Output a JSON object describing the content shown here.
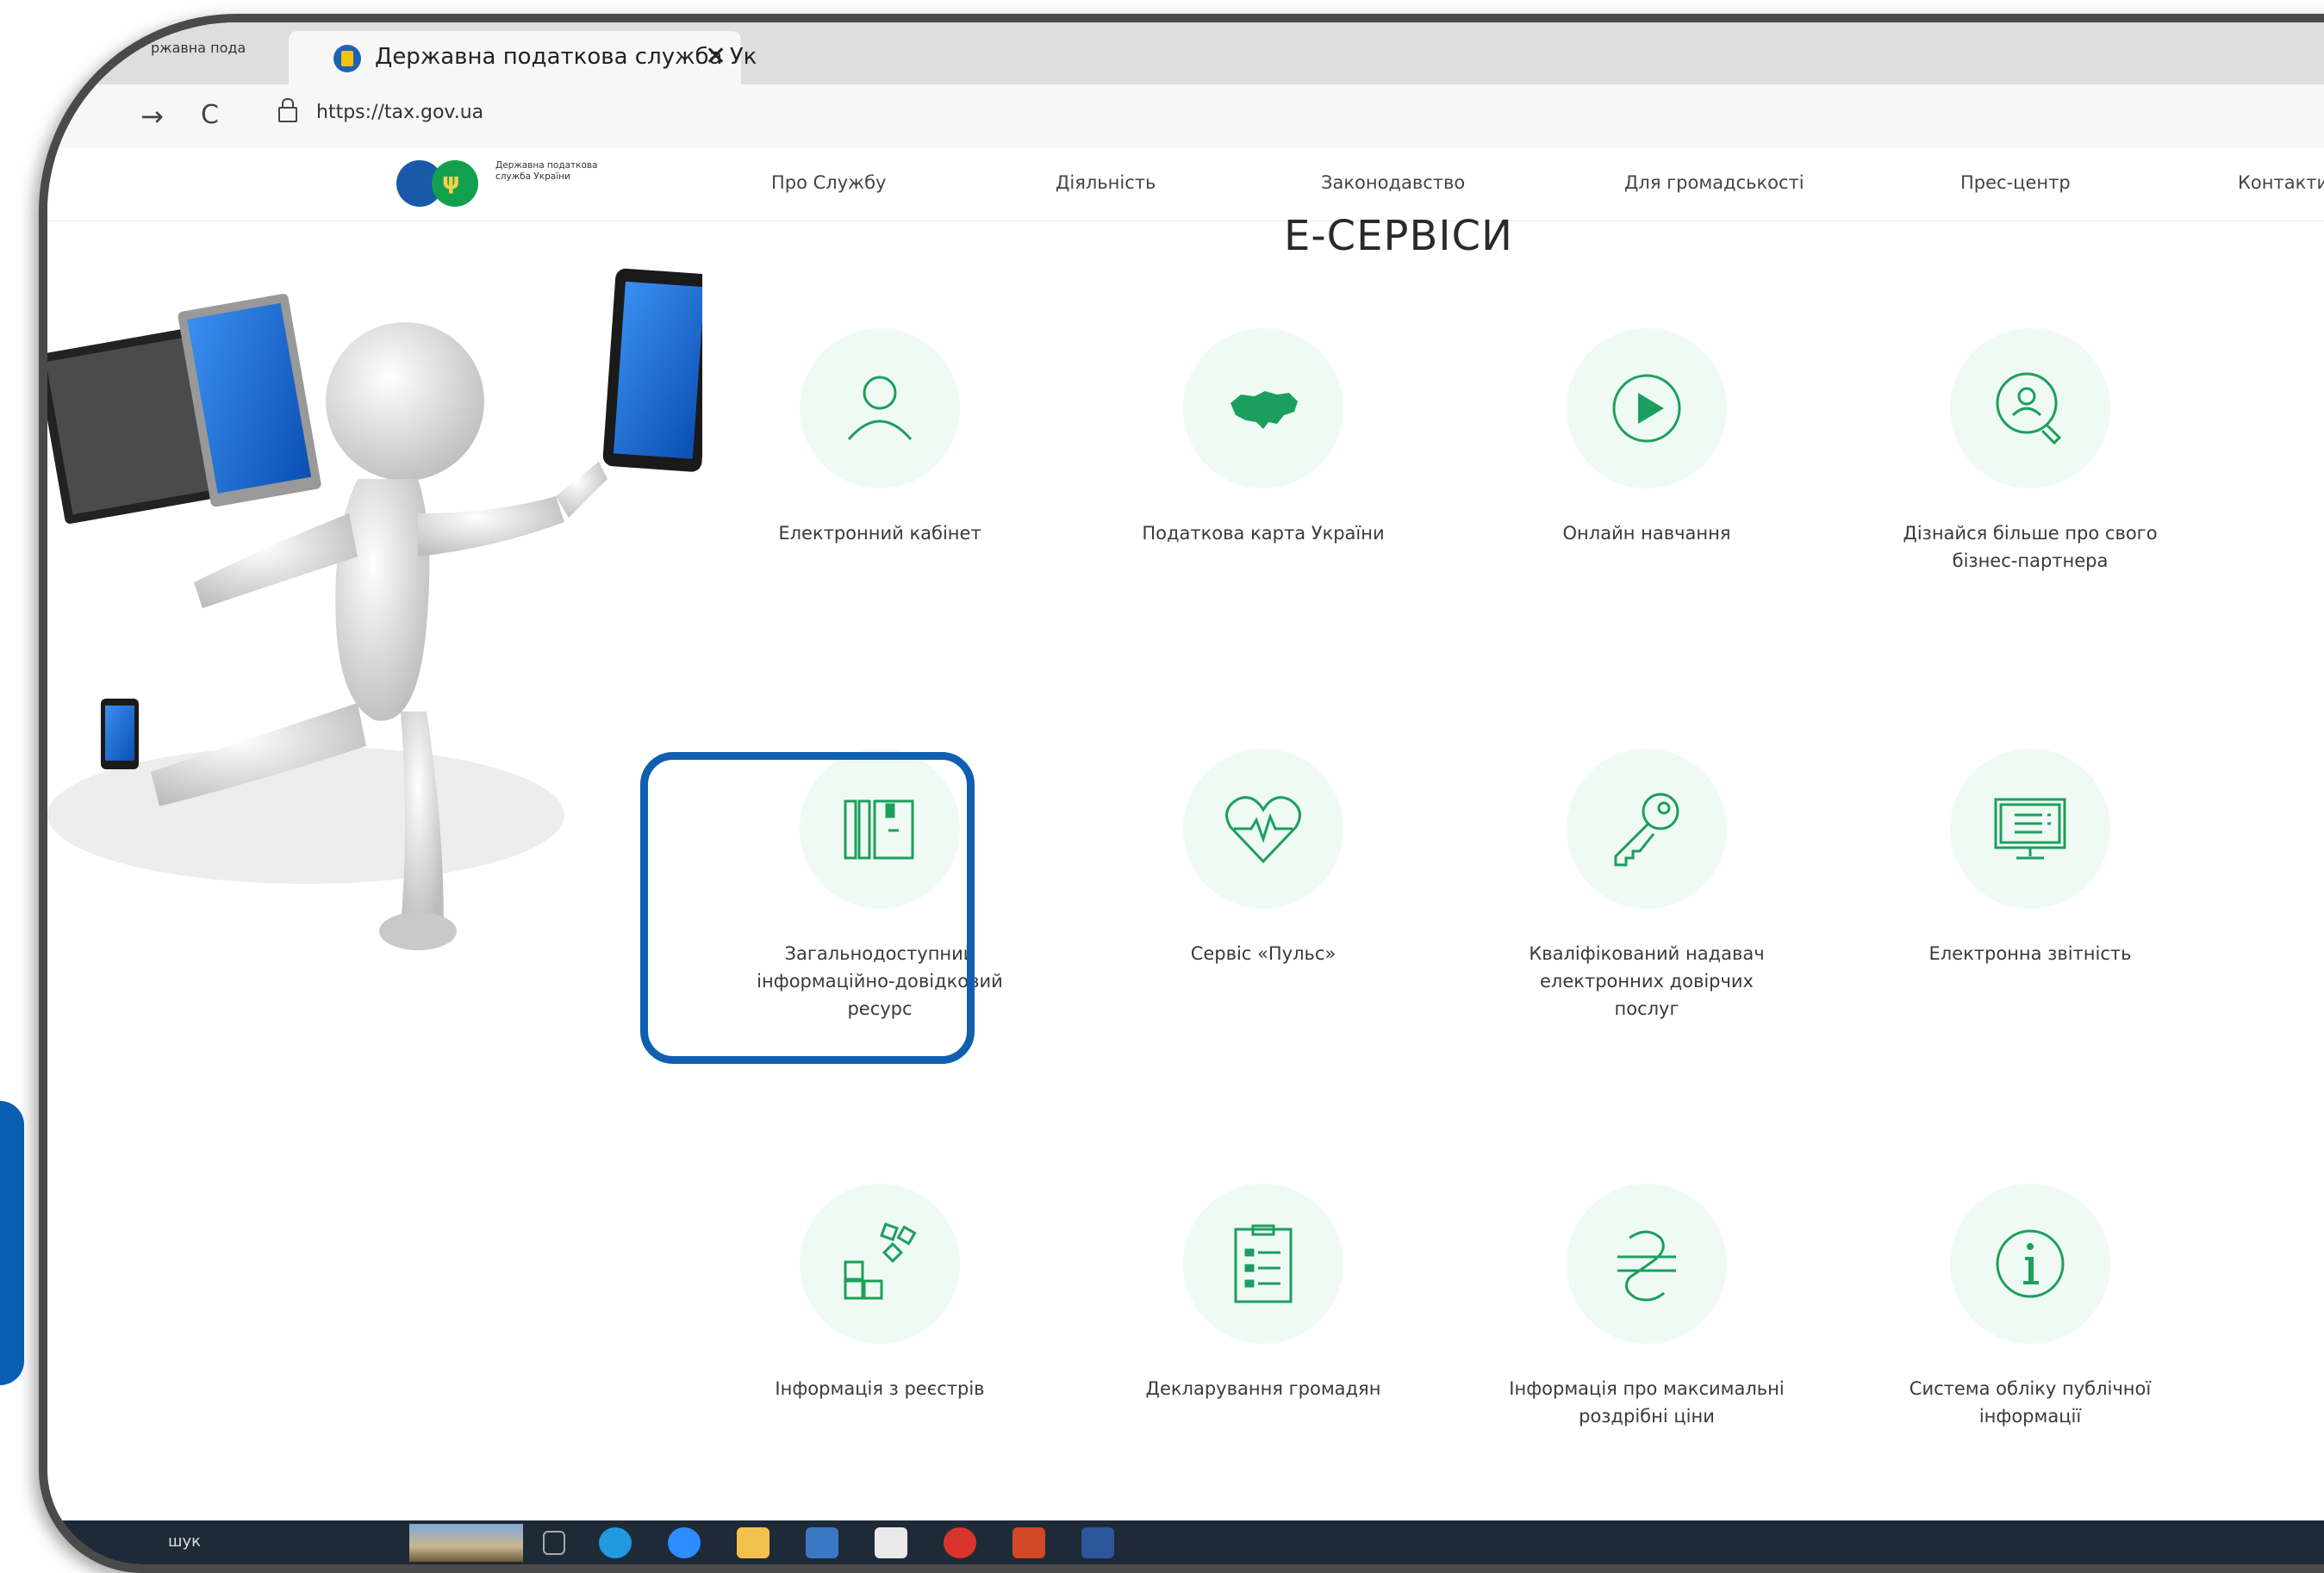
{
  "browser": {
    "prev_tab_title": "ржавна пода",
    "active_tab_title": "Державна податкова служба Ук",
    "close_glyph": "✕",
    "back_glyph": "→",
    "reload_glyph": "C",
    "url": "https://tax.gov.ua"
  },
  "site": {
    "logo_text": "Державна податкова служба України",
    "nav": [
      "Про Службу",
      "Діяльність",
      "Законодавство",
      "Для громадськості",
      "Прес-центр",
      "Контакти"
    ]
  },
  "page_title": "Е-СЕРВІСИ",
  "services": [
    {
      "label": "Електронний кабінет",
      "icon": "user-icon"
    },
    {
      "label": "Податкова карта України",
      "icon": "ukraine-map-icon"
    },
    {
      "label": "Онлайн навчання",
      "icon": "play-icon"
    },
    {
      "label": "Дізнайся більше про свого бізнес-партнера",
      "icon": "search-user-icon"
    },
    {
      "label": "Загальнодоступний інформаційно-довідковий ресурс",
      "icon": "book-archive-icon"
    },
    {
      "label": "Сервіс «Пульс»",
      "icon": "heart-pulse-icon"
    },
    {
      "label": "Кваліфікований надавач електронних довірчих послуг",
      "icon": "key-icon"
    },
    {
      "label": "Електронна звітність",
      "icon": "monitor-report-icon"
    },
    {
      "label": "Інформація з реєстрів",
      "icon": "blocks-icon"
    },
    {
      "label": "Декларування громадян",
      "icon": "clipboard-list-icon"
    },
    {
      "label": "Інформація про максимальні роздрібні ціни",
      "icon": "hryvnia-icon"
    },
    {
      "label": "Система обліку публічної інформації",
      "icon": "info-icon"
    }
  ],
  "taskbar": {
    "search_text": "шук"
  },
  "colors": {
    "accent_green": "#1c9f5e",
    "highlight_blue": "#0f5fb0",
    "circle_bg": "#f0faf4"
  }
}
